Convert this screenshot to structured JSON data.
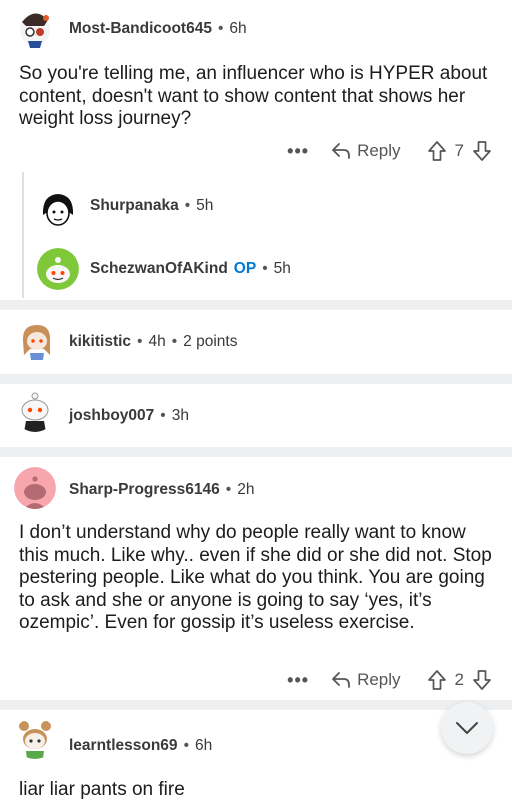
{
  "comments": [
    {
      "user": "Most-Bandicoot645",
      "time": "6h",
      "body": "So you're telling me, an influencer who is HYPER about content, doesn't want to show content that shows her weight loss journey?",
      "reply_label": "Reply",
      "votes": "7",
      "more": "•••"
    },
    {
      "user": "Shurpanaka",
      "time": "5h"
    },
    {
      "user": "SchezwanOfAKind",
      "op_badge": "OP",
      "time": "5h"
    },
    {
      "user": "kikitistic",
      "time": "4h",
      "points": "2 points"
    },
    {
      "user": "joshboy007",
      "time": "3h"
    },
    {
      "user": "Sharp-Progress6146",
      "time": "2h",
      "body": "I don’t understand why do people really want to know this much. Like why.. even if she did or she did not. Stop pestering people. Like what do you think. You are going to ask and she or anyone is going to say ‘yes, it’s ozempic’. Even for gossip it’s useless exercise.",
      "reply_label": "Reply",
      "votes": "2",
      "more": "•••"
    },
    {
      "user": "learntlesson69",
      "time": "6h",
      "body": "liar liar pants on fire"
    }
  ],
  "separator_dot": "•",
  "colors": {
    "separator": "#edeff1",
    "op_blue": "#0079d3",
    "text": "#1c1c1c",
    "meta": "#3a3a3c"
  },
  "icons": {
    "reply": "reply-arrow-icon",
    "upvote": "upvote-arrow-icon",
    "downvote": "downvote-arrow-icon",
    "scroll": "chevron-down-icon"
  }
}
